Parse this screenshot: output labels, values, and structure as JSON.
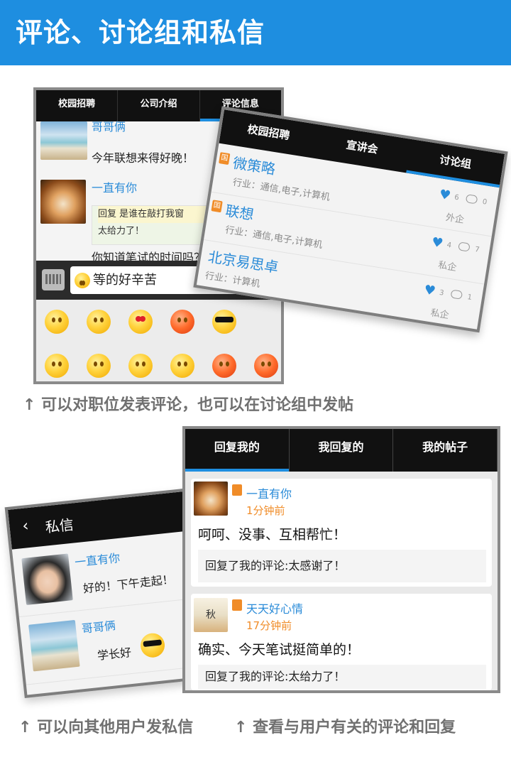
{
  "page_title": "评论、讨论组和私信",
  "captions": {
    "top": "↑ 可以对职位发表评论，也可以在讨论组中发帖",
    "bottom_left": "↑ 可以向其他用户发私信",
    "bottom_right": "↑ 查看与用户有关的评论和回复"
  },
  "screen1": {
    "tabs": [
      "校园招聘",
      "公司介绍",
      "评论信息"
    ],
    "messages": [
      {
        "user": "哥哥俩",
        "text": "今年联想来得好晚！"
      },
      {
        "user": "一直有你",
        "reply_quote": "回复 是谁在敲打我窗",
        "reply_text": "太给力了！"
      },
      {
        "text": "你知道笔试的时间吗？"
      }
    ],
    "input_value": "等的好辛苦"
  },
  "screen2": {
    "tabs": [
      "校园招聘",
      "宣讲会",
      "讨论组"
    ],
    "badge": "国",
    "companies": [
      {
        "name": "微策略",
        "industry": "行业：通信,电子,计算机",
        "likes": "6",
        "comments": "0",
        "type": "外企"
      },
      {
        "name": "联想",
        "industry": "行业：通信,电子,计算机",
        "likes": "4",
        "comments": "7",
        "type": "私企"
      },
      {
        "name": "北京易思卓",
        "industry": "行业：计算机",
        "likes": "3",
        "comments": "1",
        "type": "私企"
      }
    ]
  },
  "screen3": {
    "title": "私信",
    "back_glyph": "‹",
    "messages": [
      {
        "user": "一直有你",
        "text": "好的！下午走起！"
      },
      {
        "user": "哥哥俩",
        "text": "学长好"
      }
    ]
  },
  "screen4": {
    "tabs": [
      "回复我的",
      "我回复的",
      "我的帖子"
    ],
    "cards": [
      {
        "user": "一直有你",
        "time": "1分钟前",
        "body": "呵呵、没事、互相帮忙！",
        "quote": "回复了我的评论:太感谢了！"
      },
      {
        "user": "天天好心情",
        "avatar_text": "秋",
        "time": "17分钟前",
        "body": "确实、今天笔试挺简单的！",
        "quote": "回复了我的评论:太给力了！"
      }
    ]
  },
  "colors": {
    "accent": "#1e8ee0",
    "link": "#2a8bd8",
    "orange": "#f08c28"
  },
  "icons": [
    "keyboard-icon",
    "heart-icon",
    "comment-icon",
    "back-arrow-icon",
    "badge-icon",
    "emoji-icon"
  ]
}
